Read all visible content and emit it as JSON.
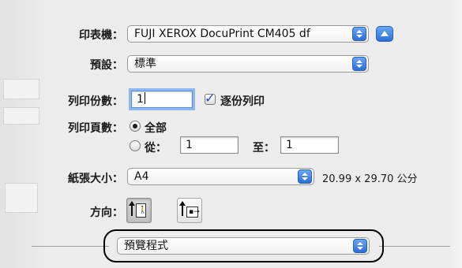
{
  "printer": {
    "label": "印表機：",
    "value": "FUJI XEROX DocuPrint CM405 df"
  },
  "presets": {
    "label": "預設：",
    "value": "標準"
  },
  "copies": {
    "label": "列印份數：",
    "value": "1",
    "collated_label": "逐份列印",
    "collated_checked": true
  },
  "pages": {
    "label": "列印頁數：",
    "all_label": "全部",
    "all_selected": true,
    "from_label": "從：",
    "from_value": "1",
    "to_label": "至：",
    "to_value": "1"
  },
  "paper_size": {
    "label": "紙張大小：",
    "value": "A4",
    "dimensions": "20.99 x 29.70 公分"
  },
  "orientation": {
    "label": "方向：",
    "selected": "portrait"
  },
  "section": {
    "value": "預覽程式"
  },
  "colors": {
    "accent": "#2b6fd6",
    "panel": "#ececec",
    "focus_ring": "#8db7f0",
    "callout": "#000000"
  },
  "icons": [
    "popup-arrows-icon",
    "disclosure-triangle-icon",
    "checkmark-icon",
    "portrait-orientation-icon",
    "landscape-orientation-icon"
  ]
}
